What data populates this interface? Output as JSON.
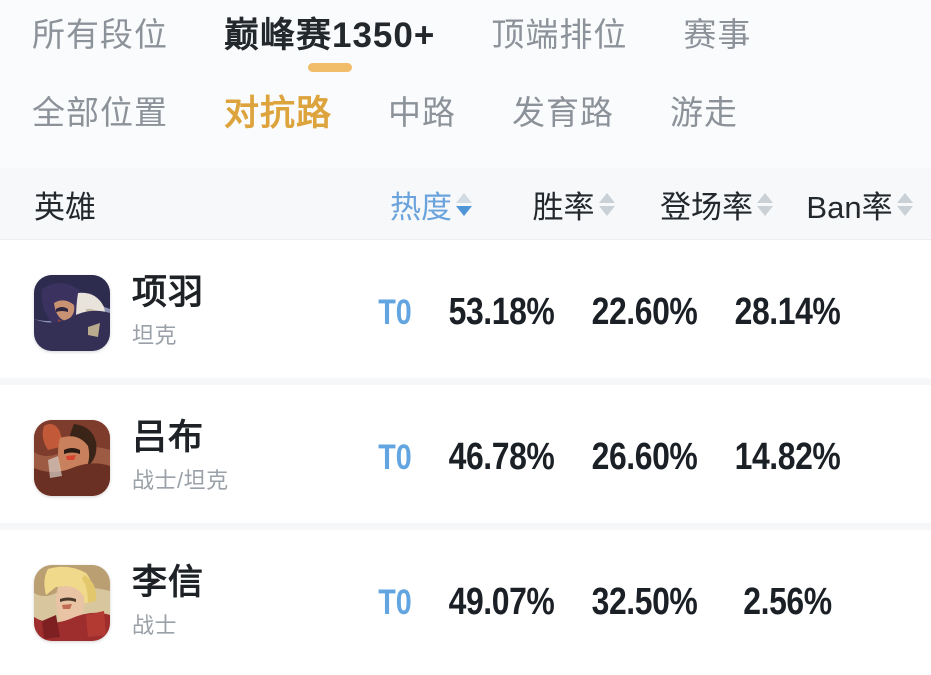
{
  "filters": {
    "rank_tabs": [
      {
        "label": "所有段位",
        "active": false
      },
      {
        "label": "巅峰赛1350+",
        "active": true
      },
      {
        "label": "顶端排位",
        "active": false
      },
      {
        "label": "赛事",
        "active": false
      }
    ],
    "lane_tabs": [
      {
        "label": "全部位置",
        "active": false
      },
      {
        "label": "对抗路",
        "active": true
      },
      {
        "label": "中路",
        "active": false
      },
      {
        "label": "发育路",
        "active": false
      },
      {
        "label": "游走",
        "active": false
      }
    ]
  },
  "table": {
    "headers": {
      "hero": "英雄",
      "heat": "热度",
      "win_rate": "胜率",
      "pick_rate": "登场率",
      "ban_rate": "Ban率"
    },
    "sort": {
      "active_column": "热度",
      "direction": "desc"
    },
    "rows": [
      {
        "name": "项羽",
        "role": "坦克",
        "tier": "T0",
        "win_rate": "53.18%",
        "pick_rate": "22.60%",
        "ban_rate": "28.14%"
      },
      {
        "name": "吕布",
        "role": "战士/坦克",
        "tier": "T0",
        "win_rate": "46.78%",
        "pick_rate": "26.60%",
        "ban_rate": "14.82%"
      },
      {
        "name": "李信",
        "role": "战士",
        "tier": "T0",
        "win_rate": "49.07%",
        "pick_rate": "32.50%",
        "ban_rate": "2.56%"
      }
    ]
  },
  "colors": {
    "accent_orange": "#dda33c",
    "underline_orange": "#f2bd6a",
    "accent_blue": "#6ba3dd",
    "tier_blue": "#63a5e0",
    "text_dark": "#1e2226",
    "text_muted": "#8c9299",
    "header_bg": "#f6f8fa"
  }
}
